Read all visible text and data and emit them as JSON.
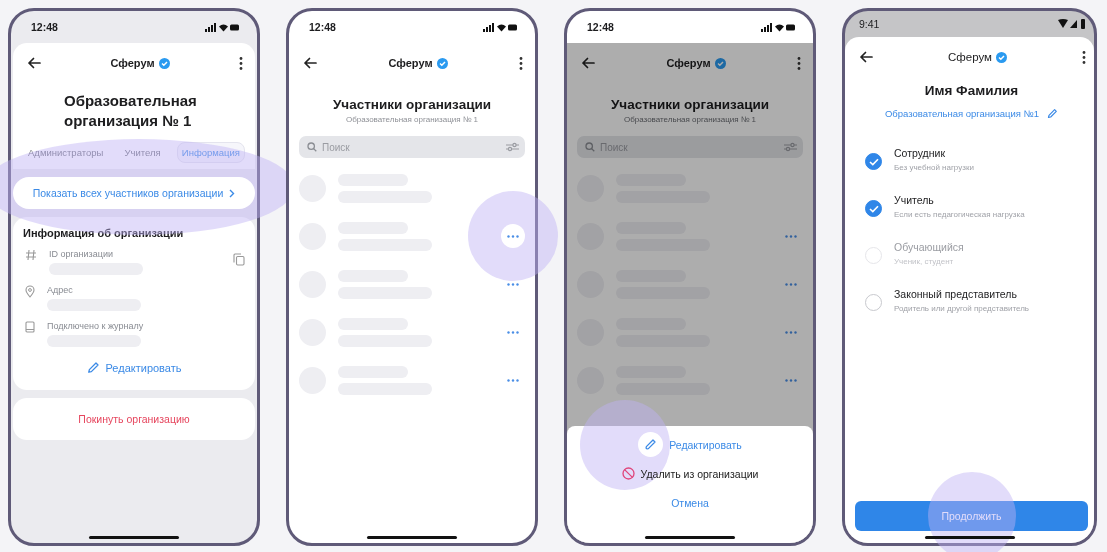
{
  "screens": [
    {
      "kind": "org_info",
      "status": {
        "kind": "ios",
        "time": "12:48"
      },
      "app_title": "Сферум",
      "title": "Образовательная организация № 1",
      "tabs": [
        {
          "label": "Администраторы",
          "selected": false
        },
        {
          "label": "Учителя",
          "selected": false
        },
        {
          "label": "Информация",
          "selected": true
        }
      ],
      "members_link": {
        "label": "Показать всех участников организации",
        "touched": true
      },
      "section_title": "Информация об организации",
      "fields": [
        {
          "kind": "id",
          "label": "ID организации",
          "copyable": true
        },
        {
          "kind": "address",
          "label": "Адрес",
          "copyable": false
        },
        {
          "kind": "journal",
          "label": "Подключено к журналу",
          "copyable": false
        }
      ],
      "edit_label": "Редактировать",
      "leave_label": "Покинуть организацию"
    },
    {
      "kind": "members",
      "status": {
        "kind": "ios",
        "time": "12:48"
      },
      "app_title": "Сферум",
      "title": "Участники организации",
      "subtitle": "Образовательная организация № 1",
      "search": {
        "placeholder": "Поиск"
      },
      "dimmed": false,
      "rows": [
        {
          "menu": false,
          "touched": false
        },
        {
          "menu": true,
          "touched": true
        },
        {
          "menu": true,
          "touched": false
        },
        {
          "menu": true,
          "touched": false
        },
        {
          "menu": true,
          "touched": false
        }
      ]
    },
    {
      "kind": "members",
      "status": {
        "kind": "ios",
        "time": "12:48"
      },
      "app_title": "Сферум",
      "title": "Участники организации",
      "subtitle": "Образовательная организация № 1",
      "search": {
        "placeholder": "Поиск"
      },
      "dimmed": true,
      "rows": [
        {
          "menu": false,
          "touched": false
        },
        {
          "menu": true,
          "touched": false
        },
        {
          "menu": true,
          "touched": false
        },
        {
          "menu": true,
          "touched": false
        },
        {
          "menu": true,
          "touched": false
        }
      ],
      "sheet": {
        "actions": [
          {
            "kind": "edit",
            "label": "Редактировать",
            "touched": true
          },
          {
            "kind": "delete",
            "label": "Удалить из организации",
            "touched": false
          },
          {
            "kind": "cancel",
            "label": "Отмена",
            "touched": false
          }
        ]
      }
    },
    {
      "kind": "roles",
      "status": {
        "kind": "android",
        "time": "9:41"
      },
      "app_title": "Сферум",
      "name": "Имя Фамилия",
      "org": "Образовательная организация №1",
      "roles": [
        {
          "label": "Сотрудник",
          "hint": "Без учебной нагрузки",
          "checked": true,
          "disabled": false
        },
        {
          "label": "Учитель",
          "hint": "Если есть педагогическая нагрузка",
          "checked": true,
          "disabled": false
        },
        {
          "label": "Обучающийся",
          "hint": "Ученик, студент",
          "checked": false,
          "disabled": true
        },
        {
          "label": "Законный представитель",
          "hint": "Родитель или другой представитель",
          "checked": false,
          "disabled": false
        }
      ],
      "continue": {
        "label": "Продолжить",
        "touched": true
      }
    }
  ]
}
